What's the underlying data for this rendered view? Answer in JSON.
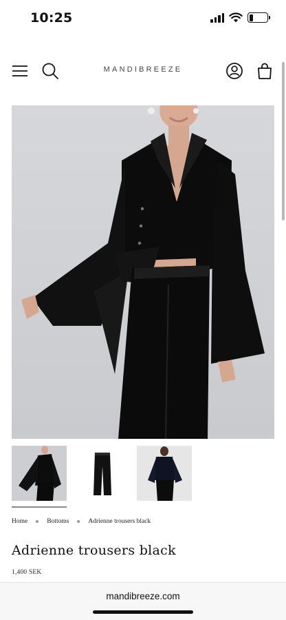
{
  "status_bar": {
    "time": "10:25",
    "icons": [
      "signal-icon",
      "wifi-icon",
      "battery-icon"
    ],
    "battery_level": 0.22
  },
  "header": {
    "logo": "MANDIBREEZE",
    "icons": [
      "menu-icon",
      "search-icon",
      "account-icon",
      "cart-icon"
    ]
  },
  "gallery": {
    "main_image": "model wearing black linen shirt tied at waist with wide bell sleeves and black trousers",
    "thumbnails": [
      {
        "label": "model front view",
        "active": true
      },
      {
        "label": "trousers flat lay",
        "active": false
      },
      {
        "label": "model back view",
        "active": false
      }
    ]
  },
  "breadcrumb": {
    "items": [
      "Home",
      "Bottoms",
      "Adrienne trousers black"
    ]
  },
  "product": {
    "title": "Adrienne trousers black",
    "price": "1,400 SEK"
  },
  "browser": {
    "url": "mandibreeze.com"
  },
  "colors": {
    "garment": "#111111",
    "background": "#d3d4d7",
    "accent": "#111111"
  }
}
